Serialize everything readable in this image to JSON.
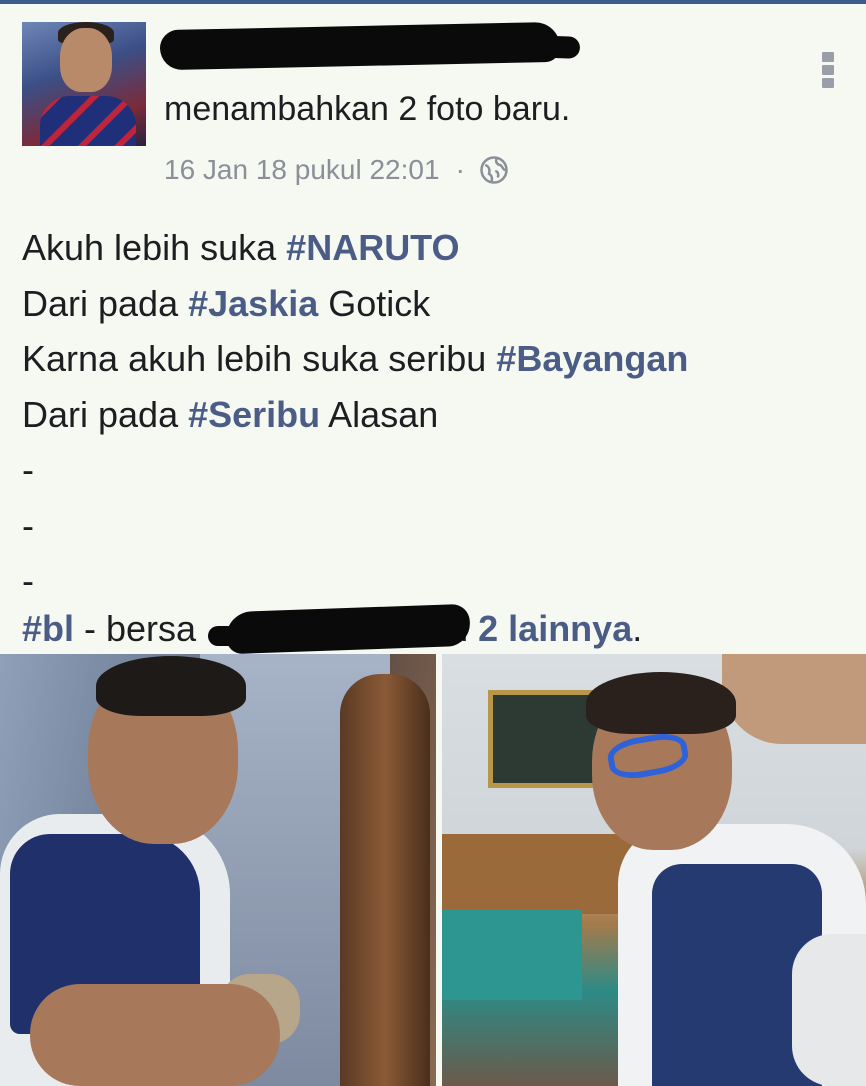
{
  "post": {
    "action_text": "menambahkan 2 foto baru.",
    "timestamp": "16 Jan 18 pukul 22:01",
    "separator": "·",
    "privacy_icon": "globe-icon",
    "menu_icon": "more-vertical-icon",
    "body_lines": [
      {
        "pre": "Akuh lebih suka ",
        "tag": "#NARUTO",
        "post": ""
      },
      {
        "pre": "Dari pada ",
        "tag": "#Jaskia",
        "post": " Gotick"
      },
      {
        "pre": "Karna akuh lebih suka seribu ",
        "tag": "#Bayangan",
        "post": ""
      },
      {
        "pre": "Dari pada ",
        "tag": "#Seribu",
        "post": " Alasan"
      }
    ],
    "dashes": [
      "-",
      "-",
      "-"
    ],
    "tagline": {
      "hashtag": "#bl",
      "with_text": " - bersa",
      "and_text": "dan ",
      "others_link": "2 lainnya",
      "end": "."
    }
  },
  "colors": {
    "background": "#f6f9f1",
    "hashtag": "#4b5d86",
    "meta": "#8b8f98",
    "topbar": "#3c5a8c"
  }
}
